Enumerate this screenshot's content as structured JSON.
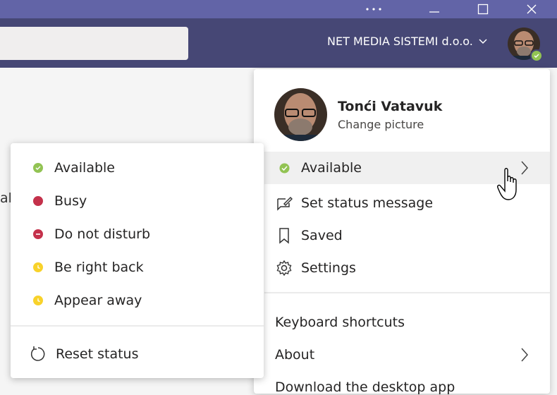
{
  "window": {
    "more_icon": "ellipsis-icon",
    "maximize_icon": "maximize-icon",
    "close_icon": "close-icon"
  },
  "header": {
    "org_name": "NET MEDIA SISTEMI d.o.o.",
    "org_chevron": "chevron-down-icon"
  },
  "background": {
    "partial_text": "aly"
  },
  "profile": {
    "name": "Tonći Vatavuk",
    "change_picture": "Change picture",
    "menu": [
      {
        "label": "Available",
        "icon": "available-presence-icon"
      },
      {
        "label": "Set status message",
        "icon": "edit-message-icon"
      },
      {
        "label": "Saved",
        "icon": "bookmark-icon"
      },
      {
        "label": "Settings",
        "icon": "gear-icon"
      }
    ],
    "keyboard_shortcuts": "Keyboard shortcuts",
    "about": "About",
    "download": "Download the desktop app"
  },
  "status_menu": {
    "items": [
      {
        "label": "Available",
        "color": "#92c353"
      },
      {
        "label": "Busy",
        "color": "#c4314b"
      },
      {
        "label": "Do not disturb",
        "color": "#c4314b"
      },
      {
        "label": "Be right back",
        "color": "#f8d22a"
      },
      {
        "label": "Appear away",
        "color": "#f8d22a"
      }
    ],
    "reset": "Reset status"
  },
  "colors": {
    "titlebar": "#6264a7",
    "header": "#464775",
    "available": "#92c353",
    "busy": "#c4314b",
    "away": "#f8d22a"
  }
}
